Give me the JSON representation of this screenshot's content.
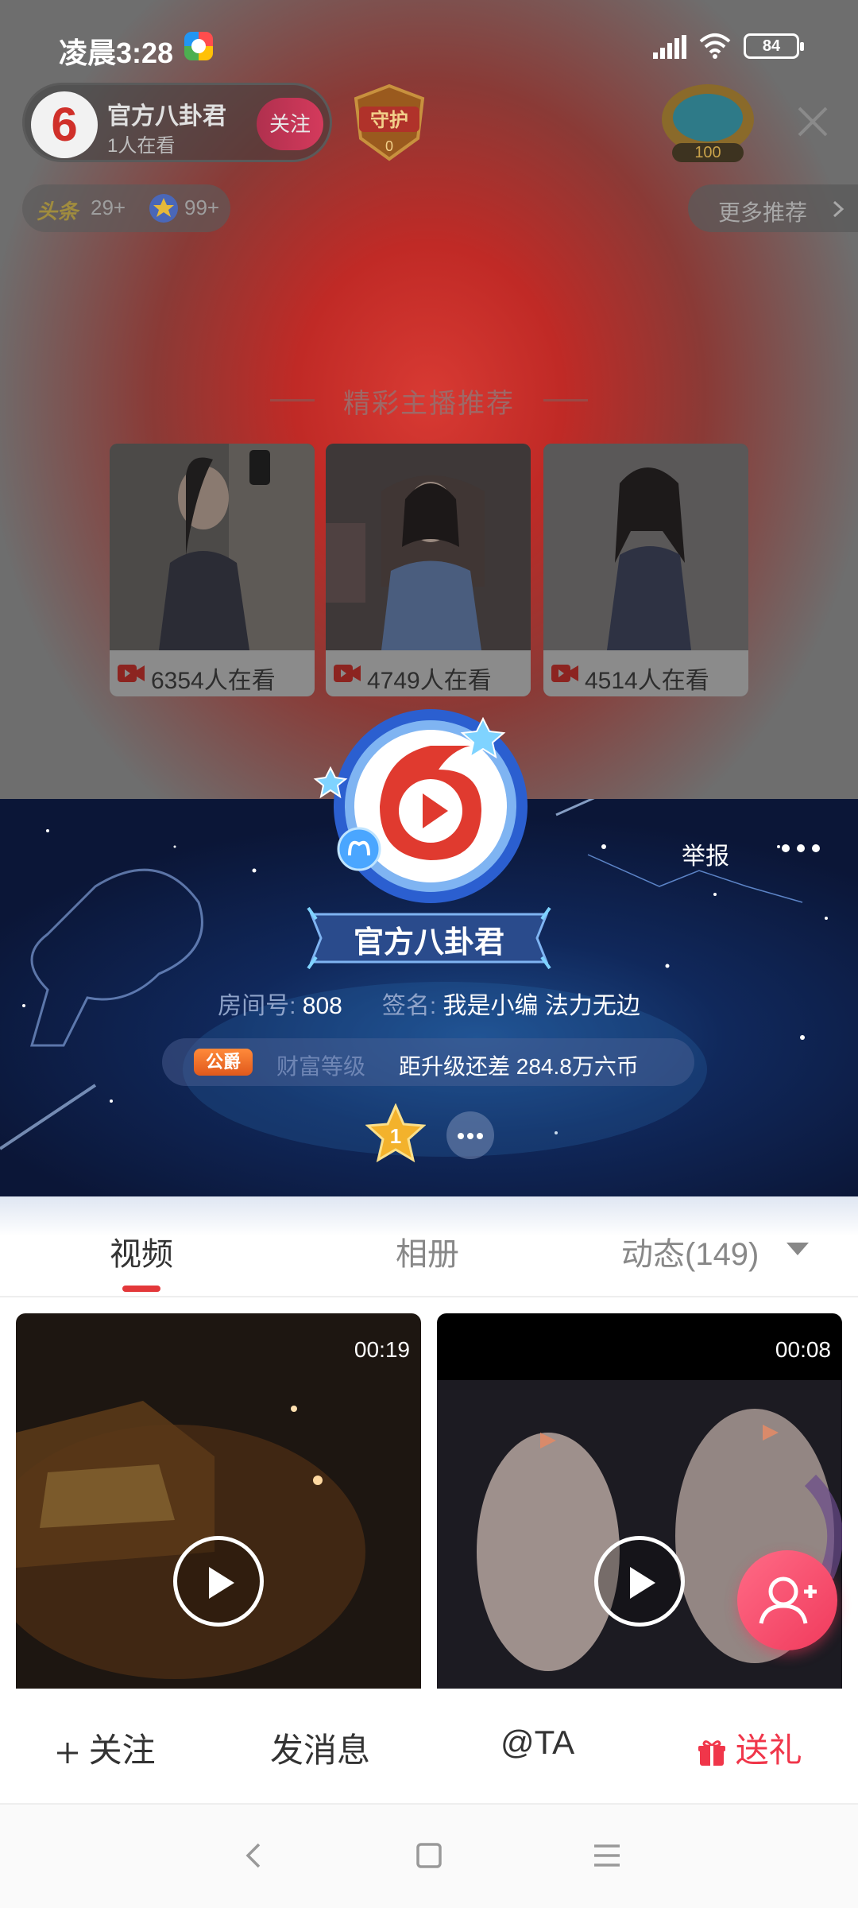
{
  "status": {
    "time": "凌晨3:28",
    "battery": "84"
  },
  "live": {
    "anchor_name": "官方八卦君",
    "online": "1人在看",
    "follow_label": "关注",
    "guard_label": "守护",
    "guard_count": "0",
    "treasure_count": "100",
    "hot_label": "头条",
    "hot_count": "29+",
    "star_count": "99+",
    "more_recommend": "更多推荐",
    "recommend_title": "精彩主播推荐",
    "recommend_cards": [
      {
        "viewers": "6354人在看"
      },
      {
        "viewers": "4749人在看"
      },
      {
        "viewers": "4514人在看"
      }
    ]
  },
  "profile": {
    "report": "举报",
    "name": "官方八卦君",
    "room_label": "房间号:",
    "room_value": "808",
    "sign_label": "签名:",
    "sign_value": "我是小编 法力无边",
    "noble_badge": "公爵",
    "wealth_label": "财富等级",
    "wealth_gap": "距升级还差 284.8万六币",
    "level": "1"
  },
  "tabs": {
    "video": "视频",
    "album": "相册",
    "feed": "动态(149)",
    "active": "视频"
  },
  "videos": [
    {
      "duration": "00:19"
    },
    {
      "duration": "00:08"
    }
  ],
  "actions": {
    "follow": "关注",
    "message": "发消息",
    "at": "@TA",
    "gift": "送礼"
  },
  "colors": {
    "accent": "#e3383a",
    "gift": "#f0364a",
    "fab": "#f03a5c",
    "banner": "#10285b"
  },
  "icons": [
    "app-icon",
    "signal-icon",
    "wifi-icon",
    "battery-icon",
    "close-icon",
    "star-icon",
    "camera-icon",
    "play-icon",
    "add-friend-icon",
    "gift-icon",
    "back-icon",
    "home-icon",
    "menu-icon",
    "chevron-down-icon"
  ]
}
